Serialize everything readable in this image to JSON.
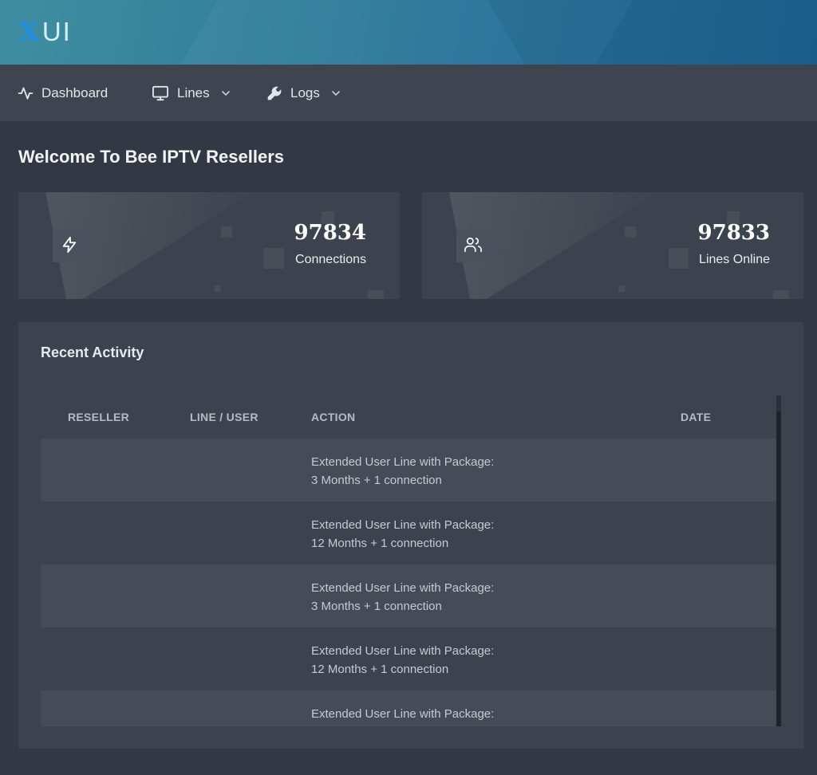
{
  "app": {
    "logo_x": "X",
    "logo_ui": "UI"
  },
  "nav": {
    "items": [
      {
        "label": "Dashboard",
        "icon": "activity-icon"
      },
      {
        "label": "Lines",
        "icon": "monitor-icon"
      },
      {
        "label": "Logs",
        "icon": "wrench-icon"
      }
    ]
  },
  "page": {
    "title": "Welcome To Bee IPTV Resellers"
  },
  "stats": [
    {
      "value": "97834",
      "label": "Connections",
      "icon": "lightning-icon"
    },
    {
      "value": "97833",
      "label": "Lines Online",
      "icon": "users-icon"
    }
  ],
  "activity": {
    "title": "Recent Activity",
    "columns": [
      "RESELLER",
      "LINE / USER",
      "ACTION",
      "DATE"
    ],
    "rows": [
      {
        "reseller": "",
        "line_user": "",
        "action_line1": "Extended User Line with Package:",
        "action_line2": "3 Months + 1 connection",
        "date": ""
      },
      {
        "reseller": "",
        "line_user": "",
        "action_line1": "Extended User Line with Package:",
        "action_line2": "12 Months + 1 connection",
        "date": ""
      },
      {
        "reseller": "",
        "line_user": "",
        "action_line1": "Extended User Line with Package:",
        "action_line2": "3 Months + 1 connection",
        "date": ""
      },
      {
        "reseller": "",
        "line_user": "",
        "action_line1": "Extended User Line with Package:",
        "action_line2": "12 Months + 1 connection",
        "date": ""
      },
      {
        "reseller": "",
        "line_user": "",
        "action_line1": "Extended User Line with Package:",
        "action_line2": "",
        "date": ""
      }
    ]
  },
  "colors": {
    "accent": "#1e90e6",
    "background": "#333944",
    "panel": "#3d434e",
    "nav": "#3f4550"
  }
}
